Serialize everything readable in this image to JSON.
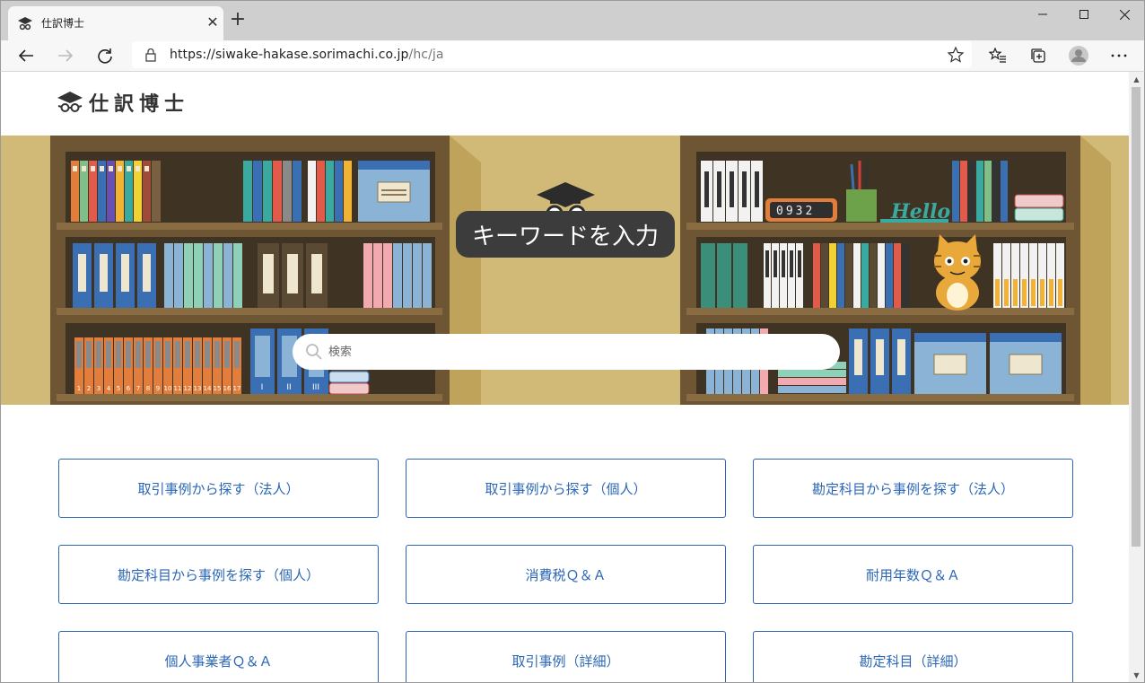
{
  "browser": {
    "tab_title": "仕訳博士",
    "url_host": "https://siwake-hakase.sorimachi.co.jp",
    "url_path": "/hc/ja"
  },
  "site": {
    "logo_text": "仕訳博士"
  },
  "hero": {
    "badge_text": "キーワードを入力",
    "search_placeholder": "検索"
  },
  "categories": [
    "取引事例から探す（法人）",
    "取引事例から探す（個人）",
    "勘定科目から事例を探す（法人）",
    "勘定科目から事例を探す（個人）",
    "消費税Ｑ＆Ａ",
    "耐用年数Ｑ＆Ａ",
    "個人事業者Ｑ＆Ａ",
    "取引事例（詳細）",
    "勘定科目（詳細）"
  ],
  "hero_art": {
    "clock_digits": "0932",
    "hello_sign": "Hello",
    "binder_numbers": [
      "1",
      "2",
      "3",
      "4",
      "5",
      "6",
      "7",
      "8",
      "9",
      "10",
      "11",
      "12",
      "13",
      "14",
      "15",
      "16",
      "17"
    ],
    "roman_numerals": [
      "I",
      "II",
      "III"
    ]
  },
  "colors": {
    "link_blue": "#2b67b6",
    "hero_tan": "#d1b977",
    "shelf_wood": "#6e5634"
  }
}
